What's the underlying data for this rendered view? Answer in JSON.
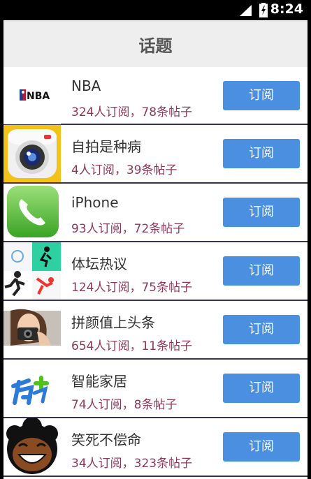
{
  "status_bar": {
    "time": "8:24"
  },
  "header": {
    "title": "话题"
  },
  "topics": [
    {
      "title": "NBA",
      "stats": "324人订阅，78条帖子",
      "button": "订阅",
      "thumb_icon": "nba-logo",
      "logo_text": "NBA"
    },
    {
      "title": "自拍是种病",
      "stats": "4人订阅，39条帖子",
      "button": "订阅",
      "thumb_icon": "camera-icon"
    },
    {
      "title": "iPhone",
      "stats": "93人订阅，72条帖子",
      "button": "订阅",
      "thumb_icon": "phone-icon"
    },
    {
      "title": "体坛热议",
      "stats": "124人订阅，75条帖子",
      "button": "订阅",
      "thumb_icon": "sports-icon"
    },
    {
      "title": "拼颜值上头条",
      "stats": "654人订阅，11条帖子",
      "button": "订阅",
      "thumb_icon": "photo-girl"
    },
    {
      "title": "智能家居",
      "stats": "74人订阅，8条帖子",
      "button": "订阅",
      "thumb_icon": "smart-home-logo"
    },
    {
      "title": "笑死不偿命",
      "stats": "34人订阅，323条帖子",
      "button": "订阅",
      "thumb_icon": "laughing-face"
    }
  ],
  "colors": {
    "button": "#4a8fe0",
    "subtitle": "#8a3a58",
    "divider": "#3a3350",
    "header_bg": "#eeeeee"
  }
}
